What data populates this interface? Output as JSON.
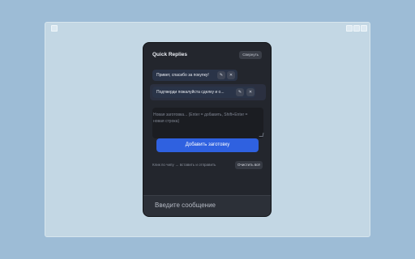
{
  "panel": {
    "title": "Quick Replies",
    "collapse_label": "Свернуть",
    "replies": [
      {
        "text": "Привет, спасибо за покупку!",
        "edit_icon": "pencil-icon",
        "delete_icon": "close-icon"
      },
      {
        "text": "Подтверди пожалуйста сделку и о...",
        "edit_icon": "pencil-icon",
        "delete_icon": "close-icon"
      }
    ],
    "composer_placeholder": "Новая заготовка... (Enter = добавить, Shift+Enter = новая строка)",
    "add_label": "Добавить заготовку",
    "hint": "Клик по чипу → вставить и отправить",
    "clear_label": "Очистить всё",
    "colors": {
      "accent": "#2f61e0",
      "panel_bg": "#23262d"
    }
  },
  "chat": {
    "message_placeholder": "Введите сообщение"
  }
}
